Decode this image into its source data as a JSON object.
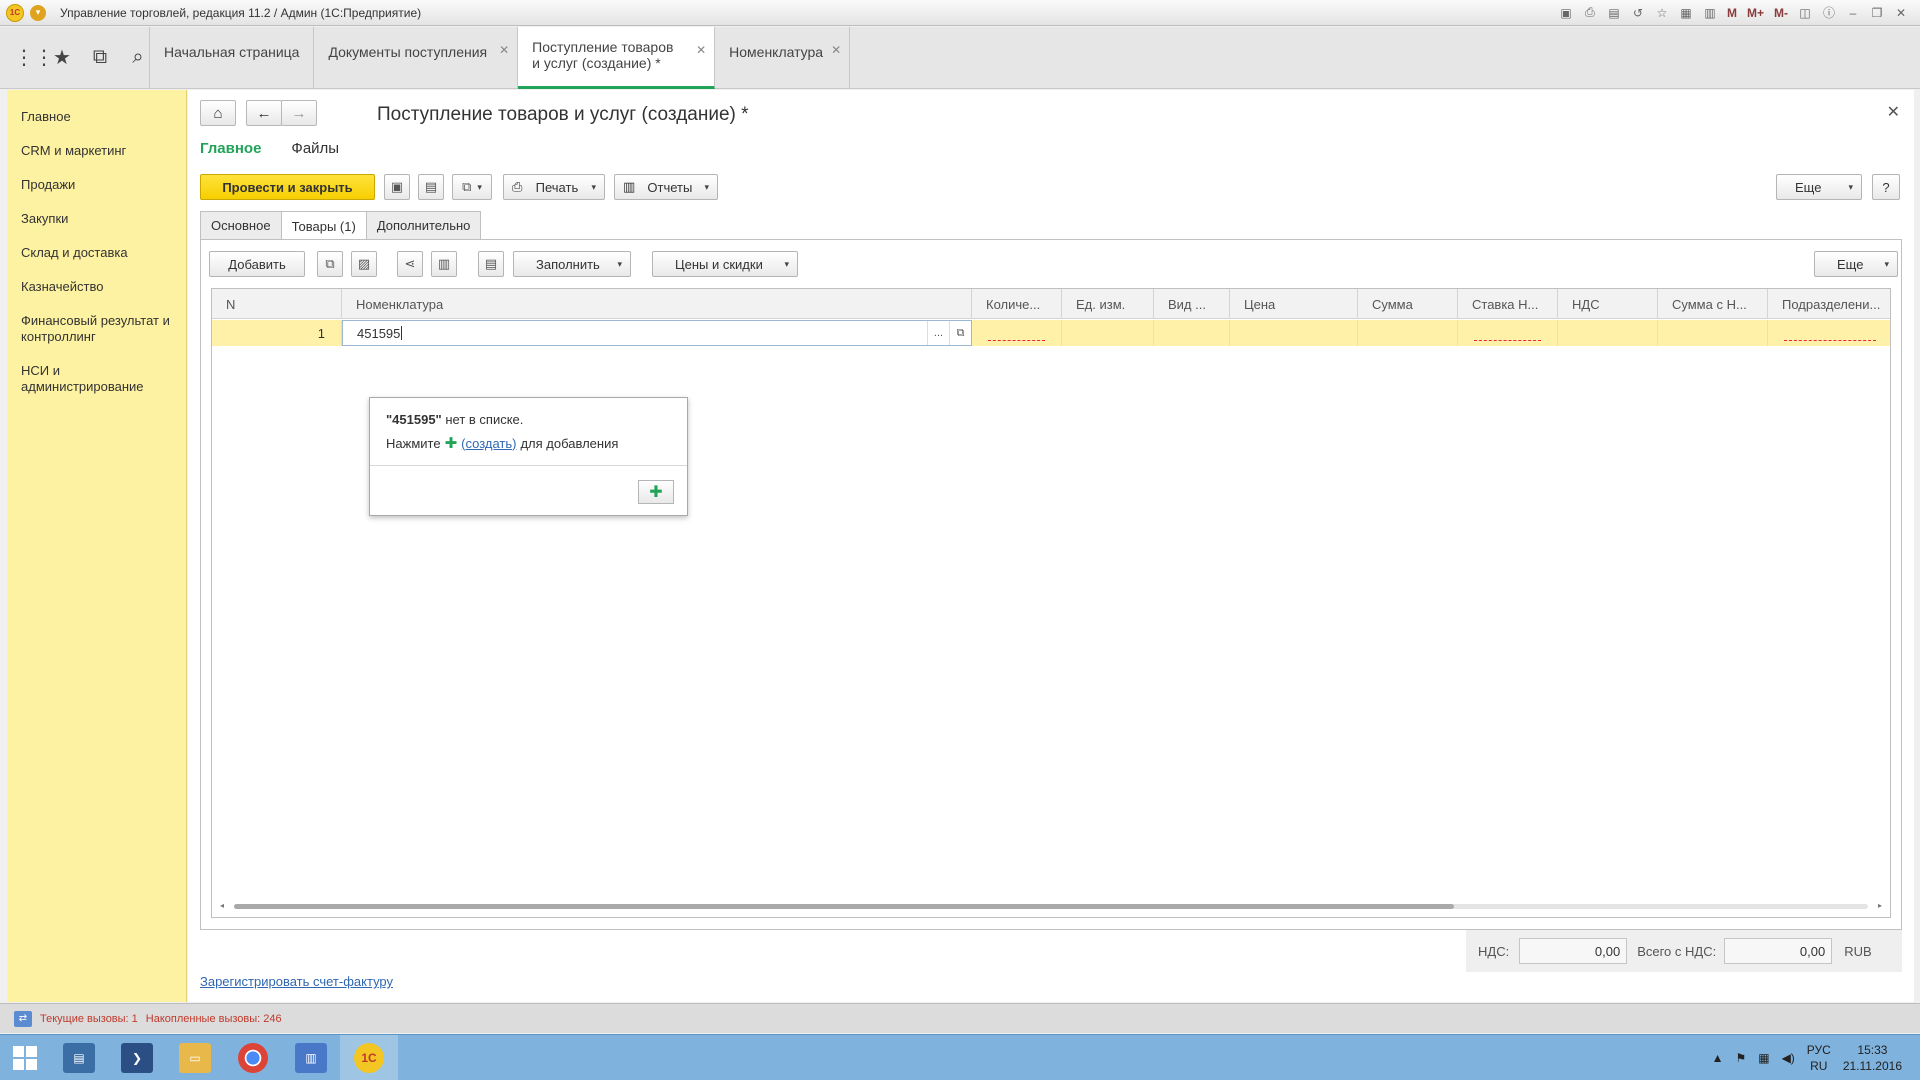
{
  "window": {
    "title": "Управление торговлей, редакция 11.2 / Админ  (1С:Предприятие)",
    "logo_text": "1С"
  },
  "titlebar_icons": [
    "save-icon",
    "print-icon",
    "preview-icon",
    "history-icon",
    "favorite-icon",
    "calc-icon",
    "calendar-icon",
    "m-icon",
    "m-plus-icon",
    "m-minus-icon",
    "panels-icon",
    "info-icon",
    "minimize-icon",
    "restore-icon",
    "close-icon"
  ],
  "titlebar_m": {
    "m": "M",
    "m_plus": "M+",
    "m_minus": "M-"
  },
  "tabs": [
    {
      "label": "Начальная страница",
      "closable": false
    },
    {
      "label": "Документы поступления",
      "closable": true
    },
    {
      "label": "Поступление товаров и услуг (создание) *",
      "closable": true,
      "active": true
    },
    {
      "label": "Номенклатура",
      "closable": true
    }
  ],
  "sidebar": {
    "items": [
      {
        "label": "Главное"
      },
      {
        "label": "CRM и маркетинг"
      },
      {
        "label": "Продажи"
      },
      {
        "label": "Закупки"
      },
      {
        "label": "Склад и доставка"
      },
      {
        "label": "Казначейство"
      },
      {
        "label": "Финансовый результат и контроллинг"
      },
      {
        "label": "НСИ и администрирование"
      }
    ]
  },
  "document": {
    "title": "Поступление товаров и услуг (создание) *",
    "subtabs": [
      "Главное",
      "Файлы"
    ],
    "toolbar": {
      "post_close": "Провести и закрыть",
      "print": "Печать",
      "reports": "Отчеты",
      "more": "Еще",
      "help": "?"
    },
    "form_tabs": [
      "Основное",
      "Товары (1)",
      "Дополнительно"
    ],
    "grid_toolbar": {
      "add": "Добавить",
      "fill": "Заполнить",
      "prices": "Цены и скидки",
      "more": "Еще"
    },
    "columns": [
      "N",
      "Номенклатура",
      "Количе...",
      "Ед. изм.",
      "Вид ...",
      "Цена",
      "Сумма",
      "Ставка Н...",
      "НДС",
      "Сумма с Н...",
      "Подразделени..."
    ],
    "row": {
      "n": "1",
      "item": "451595"
    },
    "popup": {
      "value": "\"451595\"",
      "not_in_list": "нет в списке.",
      "press": "Нажмите",
      "create_link": "(создать)",
      "to_add": "для добавления"
    },
    "totals": {
      "vat_label": "НДС:",
      "vat_value": "0,00",
      "total_label": "Всего с НДС:",
      "total_value": "0,00",
      "currency": "RUB"
    },
    "register_invoice": "Зарегистрировать счет-фактуру"
  },
  "status": {
    "current_calls": "Текущие вызовы: 1",
    "accumulated_calls": "Накопленные вызовы: 246"
  },
  "taskbar": {
    "apps": [
      "server-manager-icon",
      "powershell-icon",
      "explorer-icon",
      "chrome-icon",
      "notepad-icon",
      "onec-icon"
    ],
    "onec_label": "1С",
    "lang_top": "РУС",
    "lang_bottom": "RU",
    "time": "15:33",
    "date": "21.11.2016"
  }
}
